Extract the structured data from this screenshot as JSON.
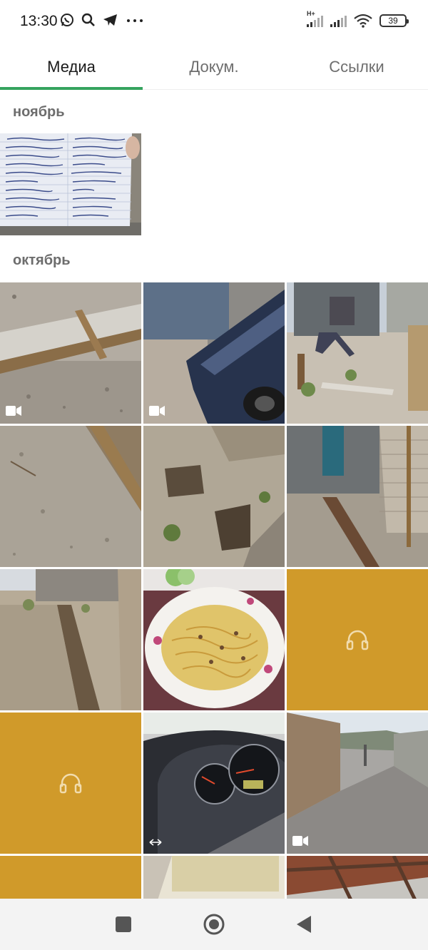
{
  "status_bar": {
    "time": "13:30",
    "network_type": "H+",
    "battery": "39",
    "icons": [
      "whatsapp-icon",
      "search-icon",
      "telegram-icon",
      "more-icon",
      "signal-icon",
      "signal-icon",
      "wifi-icon",
      "battery-icon"
    ]
  },
  "tabs": [
    {
      "label": "Медиа",
      "active": true
    },
    {
      "label": "Докум.",
      "active": false
    },
    {
      "label": "Ссылки",
      "active": false
    }
  ],
  "sections": [
    {
      "label": "ноябрь",
      "items": [
        {
          "type": "photo",
          "description": "handwritten note"
        }
      ]
    },
    {
      "label": "октябрь",
      "items": [
        {
          "type": "video"
        },
        {
          "type": "video"
        },
        {
          "type": "photo"
        },
        {
          "type": "photo"
        },
        {
          "type": "photo"
        },
        {
          "type": "photo"
        },
        {
          "type": "photo"
        },
        {
          "type": "photo"
        },
        {
          "type": "audio"
        },
        {
          "type": "audio"
        },
        {
          "type": "photo",
          "badge": "gif"
        },
        {
          "type": "video"
        },
        {
          "type": "audio"
        },
        {
          "type": "photo"
        },
        {
          "type": "photo"
        }
      ]
    }
  ],
  "colors": {
    "accent": "#35a35e",
    "audio_tile": "#d09a2a",
    "section_label": "#6d6d6d"
  },
  "nav_bar": {
    "buttons": [
      "recents-button",
      "home-button",
      "back-button"
    ]
  }
}
